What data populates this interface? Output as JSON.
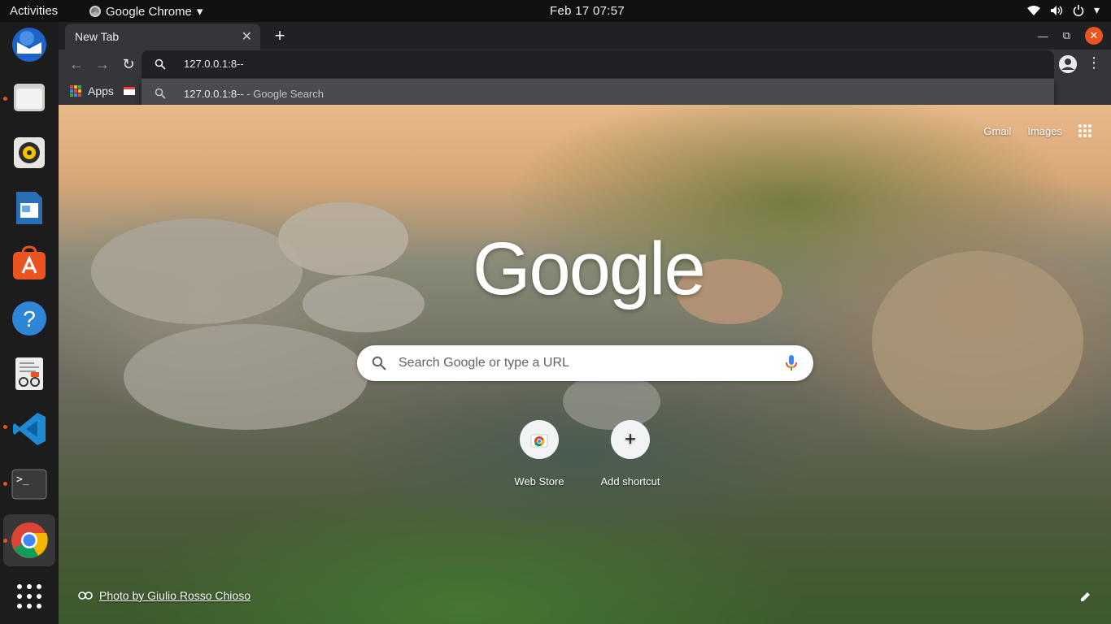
{
  "topbar": {
    "activities": "Activities",
    "app_name": "Google Chrome",
    "clock": "Feb 17  07:57"
  },
  "dock": {
    "items": [
      "thunderbird-icon",
      "files-icon",
      "rhythmbox-icon",
      "libreoffice-writer-icon",
      "software-center-icon",
      "help-icon",
      "document-viewer-icon",
      "vscode-icon",
      "terminal-icon",
      "chrome-icon",
      "show-apps-icon"
    ]
  },
  "chrome": {
    "tab": {
      "title": "New Tab"
    },
    "omnibox": {
      "value": "127.0.0.1:8--"
    },
    "bookmarks": {
      "apps": "Apps"
    },
    "suggestion": {
      "text": "127.0.0.1:8--",
      "suffix": " - Google Search"
    }
  },
  "ntp": {
    "gmail": "Gmail",
    "images": "Images",
    "logo": "Google",
    "search_placeholder": "Search Google or type a URL",
    "shortcuts": [
      {
        "label": "Web Store"
      },
      {
        "label": "Add shortcut"
      }
    ],
    "photo_credit": "Photo by Giulio Rosso Chioso"
  },
  "colors": {
    "accent_orange": "#e95420",
    "chrome_dark": "#202124",
    "toolbar": "#35363a"
  }
}
